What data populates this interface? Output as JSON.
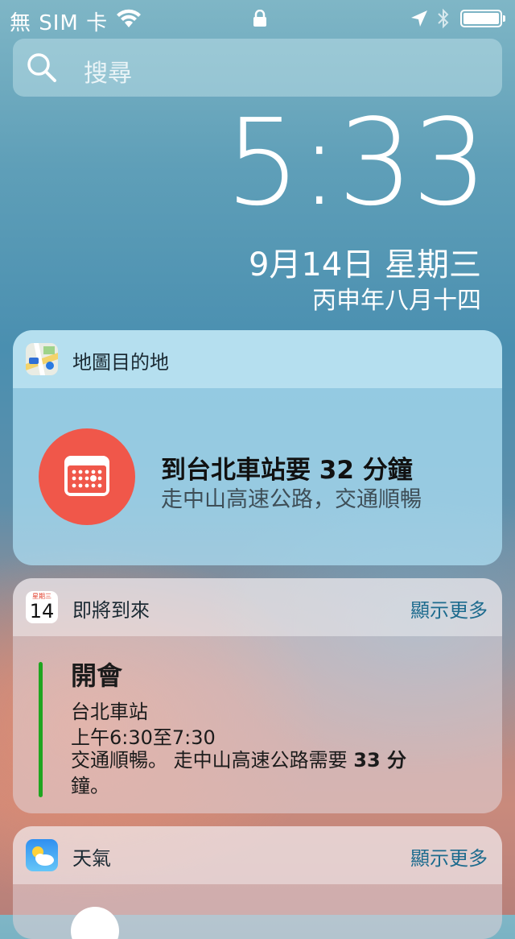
{
  "status_bar": {
    "carrier": "無 SIM 卡",
    "wifi_icon": "wifi-icon",
    "lock_icon": "lock-icon",
    "location_icon": "location-arrow-icon",
    "bluetooth_icon": "bluetooth-icon",
    "battery_level": 1.0
  },
  "search": {
    "placeholder": "搜尋",
    "icon": "search-icon"
  },
  "lockscreen": {
    "time": "5:33",
    "date": "9月14日 星期三",
    "lunar_date": "丙申年八月十四"
  },
  "maps_widget": {
    "title": "地圖目的地",
    "icon": "maps-app-icon",
    "destination_text": "到台北車站要 32 分鐘",
    "route_text": "走中山高速公路，交通順暢",
    "event_icon": "calendar-icon",
    "accent_color": "#f0574a"
  },
  "upnext_widget": {
    "title": "即將到來",
    "more_label": "顯示更多",
    "icon_weekday": "星期三",
    "icon_day": "14",
    "event_title": "開會",
    "event_location": "台北車站",
    "event_time": "上午6:30至7:30",
    "traffic_prefix": "交通順暢。 走中山高速公路需要 ",
    "traffic_minutes": "33 分",
    "traffic_suffix": "鐘。",
    "calendar_color": "#1fa51f"
  },
  "weather_widget": {
    "title": "天氣",
    "more_label": "顯示更多",
    "icon": "weather-app-icon"
  }
}
